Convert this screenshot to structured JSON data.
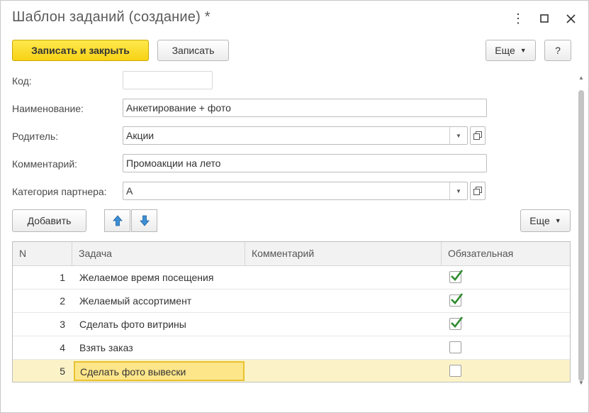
{
  "window": {
    "title": "Шаблон заданий (создание) *"
  },
  "toolbar": {
    "save_close": "Записать и закрыть",
    "save": "Записать",
    "more": "Еще",
    "help": "?"
  },
  "form": {
    "code": {
      "label": "Код:",
      "value": ""
    },
    "name": {
      "label": "Наименование:",
      "value": "Анкетирование + фото"
    },
    "parent": {
      "label": "Родитель:",
      "value": "Акции"
    },
    "comment": {
      "label": "Комментарий:",
      "value": "Промоакции на лето"
    },
    "category": {
      "label": "Категория партнера:",
      "value": "А"
    }
  },
  "table_toolbar": {
    "add": "Добавить",
    "more": "Еще"
  },
  "table": {
    "columns": [
      "N",
      "Задача",
      "Комментарий",
      "Обязательная"
    ],
    "rows": [
      {
        "n": "1",
        "task": "Желаемое время посещения",
        "comment": "",
        "required": true
      },
      {
        "n": "2",
        "task": "Желаемый ассортимент",
        "comment": "",
        "required": true
      },
      {
        "n": "3",
        "task": "Сделать фото витрины",
        "comment": "",
        "required": true
      },
      {
        "n": "4",
        "task": "Взять заказ",
        "comment": "",
        "required": false
      },
      {
        "n": "5",
        "task": "Сделать фото вывески",
        "comment": "",
        "required": false
      }
    ],
    "selected_row": 5
  },
  "colors": {
    "accent": "#f7d215",
    "selected_row": "#fbf2c8",
    "check": "#2e8b2e",
    "arrow": "#3c8fd6"
  },
  "icons": [
    "more-vert-icon",
    "maximize-icon",
    "close-icon",
    "dropdown-icon",
    "open-form-icon",
    "arrow-up-icon",
    "arrow-down-icon",
    "checkmark-icon"
  ]
}
